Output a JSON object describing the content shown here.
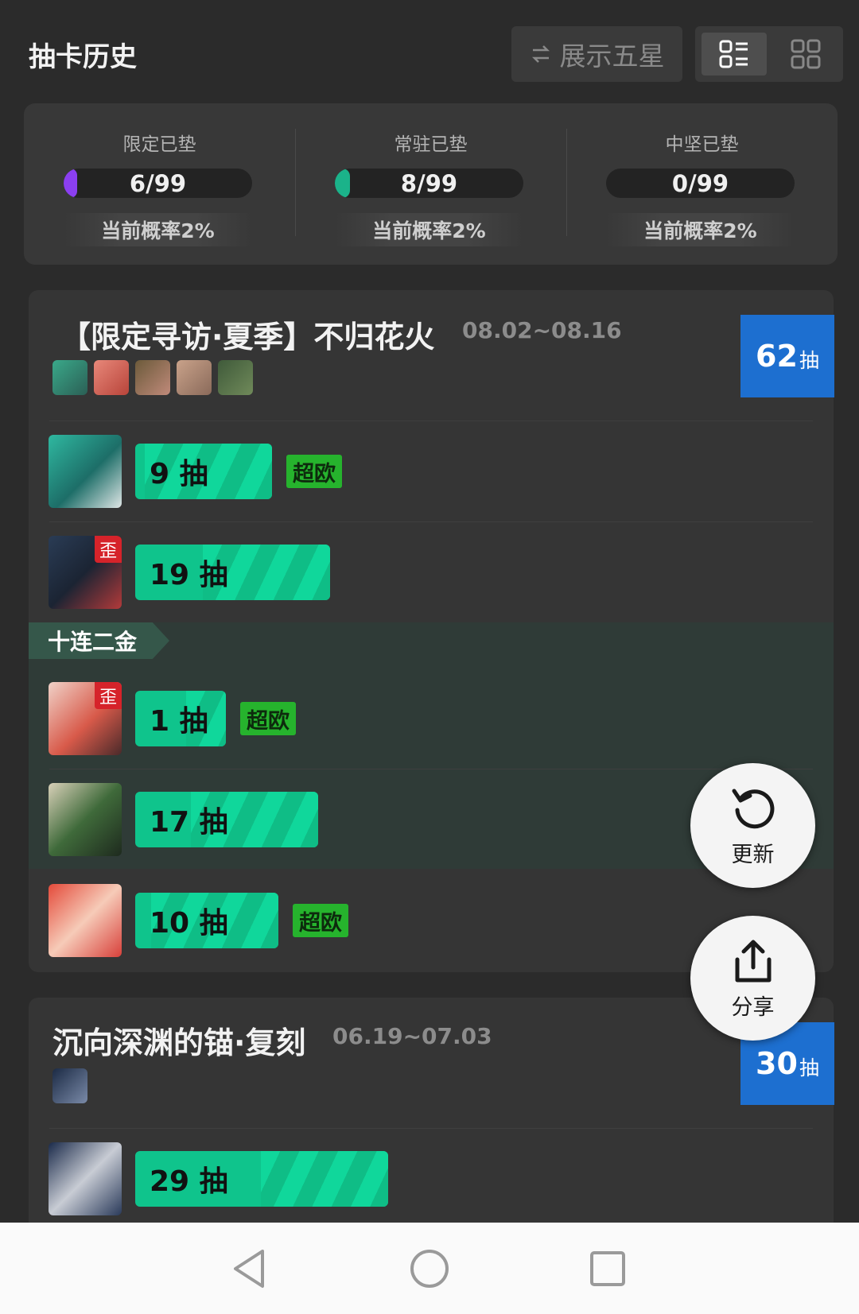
{
  "header": {
    "title": "抽卡历史",
    "toggle_label": "展示五星"
  },
  "pity": [
    {
      "label": "限定已垫",
      "value": "6/99",
      "fraction": 0.0606,
      "color": "#8b3ff0",
      "rate": "当前概率2%"
    },
    {
      "label": "常驻已垫",
      "value": "8/99",
      "fraction": 0.0808,
      "color": "#1bb38a",
      "rate": "当前概率2%"
    },
    {
      "label": "中坚已垫",
      "value": "0/99",
      "fraction": 0,
      "color": "#1bb38a",
      "rate": "当前概率2%"
    }
  ],
  "banners": [
    {
      "name": "【限定寻访·夏季】不归花火",
      "dates": "08.02~08.16",
      "total": "62",
      "total_unit": "抽",
      "rows": [
        {
          "pulls": "9 抽",
          "lucky": "超欧",
          "wai": null
        },
        {
          "pulls": "19 抽",
          "lucky": null,
          "wai": "歪"
        }
      ],
      "multi_group": {
        "label": "十连二金",
        "rows": [
          {
            "pulls": "1 抽",
            "lucky": "超欧",
            "wai": "歪"
          },
          {
            "pulls": "17 抽",
            "lucky": null,
            "wai": null
          }
        ]
      },
      "rows_after": [
        {
          "pulls": "10 抽",
          "lucky": "超欧",
          "wai": null
        }
      ]
    },
    {
      "name": "沉向深渊的锚·复刻",
      "dates": "06.19~07.03",
      "total": "30",
      "total_unit": "抽",
      "rows": [
        {
          "pulls": "29 抽",
          "lucky": null,
          "wai": null
        }
      ]
    }
  ],
  "fabs": {
    "refresh_label": "更新",
    "share_label": "分享"
  },
  "colors": {
    "accent_green": "#0fc48c",
    "badge_blue": "#1d6fd0",
    "lucky_green": "#26b32d",
    "wai_red": "#d6232a"
  }
}
